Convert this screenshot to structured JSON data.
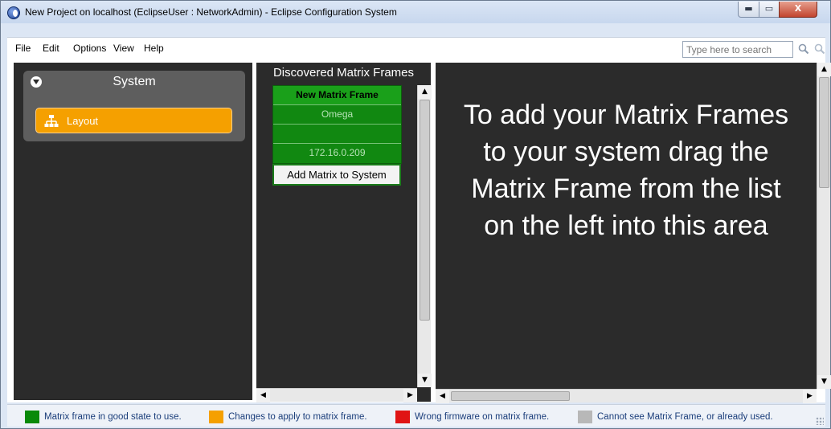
{
  "window": {
    "title": "New Project on localhost (EclipseUser : NetworkAdmin) - Eclipse Configuration System",
    "controls": {
      "minimize": "▬",
      "maximize": "▭",
      "close": "X"
    }
  },
  "menu": {
    "items": [
      "File",
      "Edit",
      "Options",
      "View",
      "Help"
    ]
  },
  "search": {
    "placeholder": "Type here to search"
  },
  "sidebar": {
    "section_title": "System",
    "items": [
      {
        "label": "Layout"
      }
    ]
  },
  "discovered": {
    "title": "Discovered Matrix Frames",
    "frame": {
      "name": "New Matrix Frame",
      "type": "Omega",
      "extra": "",
      "ip": "172.16.0.209"
    },
    "add_button": "Add Matrix to System"
  },
  "drop_area": {
    "message": "To add your Matrix Frames to your system drag the Matrix Frame from the list on the left into this area"
  },
  "legend": [
    {
      "label": "Matrix frame in good state to use.",
      "color": "#0a8a0a"
    },
    {
      "label": "Changes to apply to matrix frame.",
      "color": "#f5a000"
    },
    {
      "label": "Wrong firmware on matrix frame.",
      "color": "#e01414"
    },
    {
      "label": "Cannot see Matrix Frame, or already used.",
      "color": "#b8b8b8"
    }
  ],
  "colors": {
    "accent": "#f5a000",
    "panel": "#2b2b2b",
    "frame_green": "#118811"
  },
  "icons": {
    "app": "eclipse-app-icon",
    "search": "search-icon",
    "layout": "layout-network-icon"
  }
}
